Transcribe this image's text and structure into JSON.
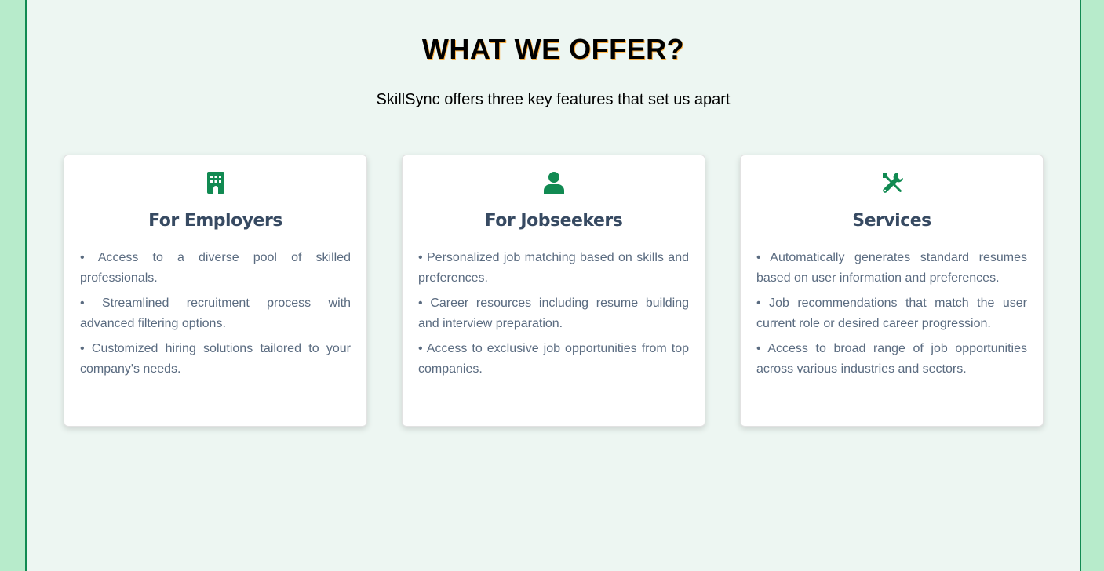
{
  "section": {
    "title": "WHAT WE OFFER?",
    "subtitle": "SkillSync offers three key features that set us apart"
  },
  "colors": {
    "accent": "#118a52",
    "background_outer": "#b7ebcb",
    "background_panel": "#edf6f2",
    "card_heading": "#374a62",
    "card_text": "#5a6b80"
  },
  "cards": [
    {
      "icon": "building-icon",
      "title": "For Employers",
      "items": [
        "• Access to a diverse pool of skilled professionals.",
        "• Streamlined recruitment process with advanced filtering options.",
        "• Customized hiring solutions tailored to your company's needs."
      ]
    },
    {
      "icon": "user-icon",
      "title": "For Jobseekers",
      "items": [
        "• Personalized job matching based on skills and preferences.",
        "• Career resources including resume building and interview preparation.",
        "• Access to exclusive job opportunities from top companies."
      ]
    },
    {
      "icon": "tools-icon",
      "title": "Services",
      "items": [
        "• Automatically generates standard resumes based on user information and preferences.",
        "• Job recommendations that match the user current role or desired career progression.",
        "• Access to broad range of job opportunities across various industries and sectors."
      ]
    }
  ]
}
